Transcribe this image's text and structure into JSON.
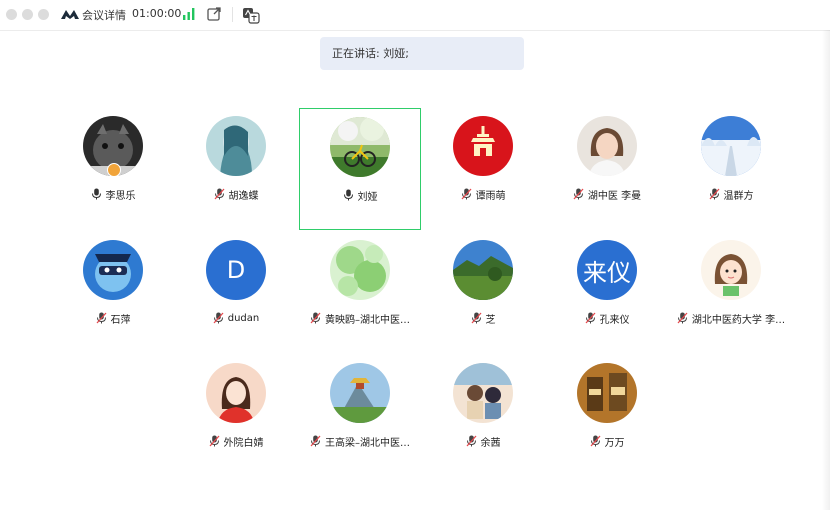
{
  "titlebar": {
    "title": "会议详情",
    "timer": "01:00:00"
  },
  "banner": {
    "text": "正在讲话: 刘娅;"
  },
  "participants": [
    {
      "name": "李思乐",
      "mic": "on",
      "host": true,
      "avatar": "cat-photo"
    },
    {
      "name": "胡逸蝶",
      "mic": "muted",
      "avatar": "anime-girl"
    },
    {
      "name": "刘娅",
      "mic": "on",
      "active": true,
      "avatar": "bicycle-photo"
    },
    {
      "name": "谭雨萌",
      "mic": "muted",
      "avatar": "red-gate"
    },
    {
      "name": "湖中医 李曼",
      "mic": "muted",
      "avatar": "woman-portrait"
    },
    {
      "name": "温群方",
      "mic": "muted",
      "avatar": "snow-road"
    },
    {
      "name": "石萍",
      "mic": "muted",
      "avatar": "cartoon-character"
    },
    {
      "name": "dudan",
      "mic": "muted",
      "avatar": "letter",
      "letter": "D"
    },
    {
      "name": "黄映鸥–湖北中医…",
      "mic": "muted",
      "avatar": "green-leaves"
    },
    {
      "name": "芝",
      "mic": "muted",
      "avatar": "mountain-landscape"
    },
    {
      "name": "孔来仪",
      "mic": "muted",
      "avatar": "letter",
      "letter": "来仪"
    },
    {
      "name": "湖北中医药大学 李…",
      "mic": "muted",
      "avatar": "cartoon-girl"
    },
    {
      "name": "外院白婧",
      "mic": "muted",
      "avatar": "cartoon-woman"
    },
    {
      "name": "王高梁–湖北中医…",
      "mic": "muted",
      "avatar": "pavilion"
    },
    {
      "name": "余茜",
      "mic": "muted",
      "avatar": "illustration-girls"
    },
    {
      "name": "万万",
      "mic": "muted",
      "avatar": "tea-tins"
    }
  ],
  "colors": {
    "active_border": "#2fcd6a",
    "banner_bg": "#e8edf7",
    "signal": "#22c55e",
    "letter_avatar": "#2a6fd1"
  }
}
